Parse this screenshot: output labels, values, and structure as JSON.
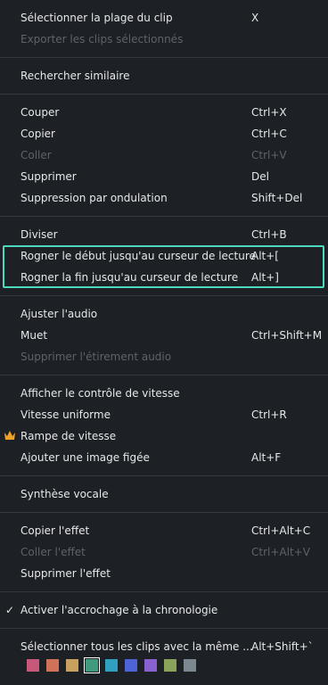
{
  "menu": {
    "items": [
      {
        "label": "Sélectionner la plage du clip",
        "shortcut": "X",
        "enabled": true
      },
      {
        "label": "Exporter les clips sélectionnés",
        "shortcut": "",
        "enabled": false
      },
      {
        "label": "Rechercher similaire",
        "shortcut": "",
        "enabled": true
      },
      {
        "label": "Couper",
        "shortcut": "Ctrl+X",
        "enabled": true
      },
      {
        "label": "Copier",
        "shortcut": "Ctrl+C",
        "enabled": true
      },
      {
        "label": "Coller",
        "shortcut": "Ctrl+V",
        "enabled": false
      },
      {
        "label": "Supprimer",
        "shortcut": "Del",
        "enabled": true
      },
      {
        "label": "Suppression par ondulation",
        "shortcut": "Shift+Del",
        "enabled": true
      },
      {
        "label": "Diviser",
        "shortcut": "Ctrl+B",
        "enabled": true
      },
      {
        "label": "Rogner le début jusqu'au curseur de lecture",
        "shortcut": "Alt+[",
        "enabled": true
      },
      {
        "label": "Rogner la fin jusqu'au curseur de lecture",
        "shortcut": "Alt+]",
        "enabled": true
      },
      {
        "label": "Ajuster l'audio",
        "shortcut": "",
        "enabled": true
      },
      {
        "label": "Muet",
        "shortcut": "Ctrl+Shift+M",
        "enabled": true
      },
      {
        "label": "Supprimer l'étirement audio",
        "shortcut": "",
        "enabled": false
      },
      {
        "label": "Afficher le contrôle de vitesse",
        "shortcut": "",
        "enabled": true
      },
      {
        "label": "Vitesse uniforme",
        "shortcut": "Ctrl+R",
        "enabled": true
      },
      {
        "label": "Rampe de vitesse",
        "shortcut": "",
        "enabled": true,
        "icon": "crown-icon"
      },
      {
        "label": "Ajouter une image figée",
        "shortcut": "Alt+F",
        "enabled": true
      },
      {
        "label": "Synthèse vocale",
        "shortcut": "",
        "enabled": true
      },
      {
        "label": "Copier l'effet",
        "shortcut": "Ctrl+Alt+C",
        "enabled": true
      },
      {
        "label": "Coller l'effet",
        "shortcut": "Ctrl+Alt+V",
        "enabled": false
      },
      {
        "label": "Supprimer l'effet",
        "shortcut": "",
        "enabled": true
      },
      {
        "label": "Activer l'accrochage à la chronologie",
        "shortcut": "",
        "enabled": true,
        "checked": true,
        "check_glyph": "✓"
      },
      {
        "label": "Sélectionner tous les clips avec la même ...",
        "shortcut": "Alt+Shift+`",
        "enabled": true
      }
    ],
    "highlight_color": "#4dd9c0",
    "color_swatches": [
      "#c8587a",
      "#d0715a",
      "#c9a15e",
      "#3f9a7e",
      "#2fa0bf",
      "#4d63d6",
      "#8a62d0",
      "#8aa35a",
      "#7c8890"
    ],
    "selected_swatch_index": 3
  }
}
